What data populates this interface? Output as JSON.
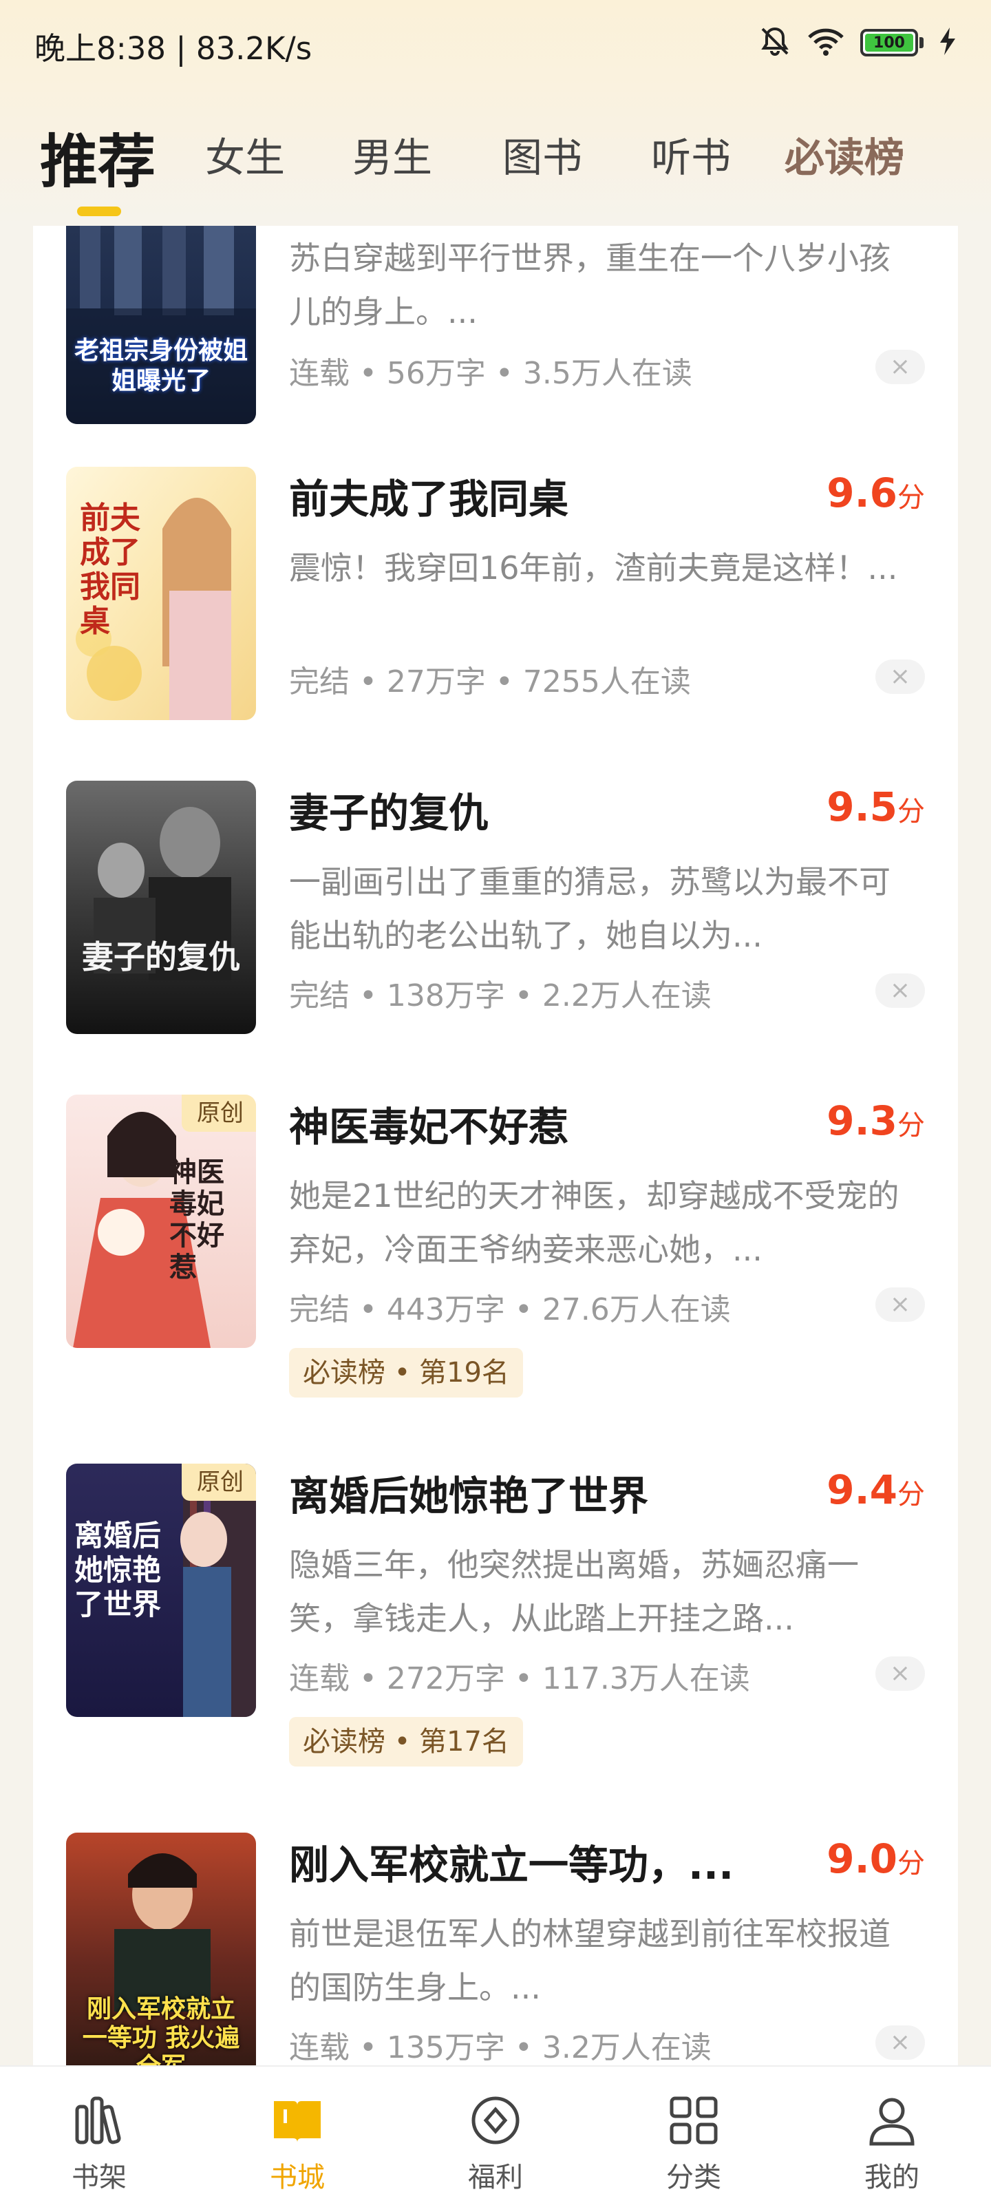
{
  "status_bar": {
    "time_speed": "晚上8:38 | 83.2K/s",
    "battery": "100",
    "icons": [
      "mute-bell-icon",
      "wifi-icon",
      "battery-icon",
      "charging-icon"
    ]
  },
  "tabs": [
    {
      "label": "推荐",
      "active": true
    },
    {
      "label": "女生"
    },
    {
      "label": "男生"
    },
    {
      "label": "图书"
    },
    {
      "label": "听书"
    },
    {
      "label": "必读榜"
    }
  ],
  "books": [
    {
      "title": "",
      "desc": "苏白穿越到平行世界，重生在一个八岁小孩儿的身上。...",
      "meta": "连载 • 56万字 • 3.5万人在读",
      "cover_text": "老祖宗身份被姐姐曝光了"
    },
    {
      "title": "前夫成了我同桌",
      "score": "9.6",
      "score_unit": "分",
      "desc": "震惊！我穿回16年前，渣前夫竟是这样！...",
      "meta": "完结 • 27万字 • 7255人在读",
      "cover_text": "前夫成了我同桌"
    },
    {
      "title": "妻子的复仇",
      "score": "9.5",
      "score_unit": "分",
      "desc": "一副画引出了重重的猜忌，苏鹭以为最不可能出轨的老公出轨了，她自以为...",
      "meta": "完结 • 138万字 • 2.2万人在读",
      "cover_text": "妻子的复仇"
    },
    {
      "title": "神医毒妃不好惹",
      "score": "9.3",
      "score_unit": "分",
      "desc": "她是21世纪的天才神医，却穿越成不受宠的弃妃，冷面王爷纳妾来恶心她，...",
      "meta": "完结 • 443万字 • 27.6万人在读",
      "badge": "原创",
      "rank_tag": "必读榜 • 第19名",
      "cover_text": "神医毒妃不好惹"
    },
    {
      "title": "离婚后她惊艳了世界",
      "score": "9.4",
      "score_unit": "分",
      "desc": "隐婚三年，他突然提出离婚，苏婳忍痛一笑，拿钱走人，从此踏上开挂之路...",
      "meta": "连载 • 272万字 • 117.3万人在读",
      "badge": "原创",
      "rank_tag": "必读榜 • 第17名",
      "cover_text": "离婚后她惊艳了世界"
    },
    {
      "title": "刚入军校就立一等功，...",
      "score": "9.0",
      "score_unit": "分",
      "desc": "前世是退伍军人的林望穿越到前往军校报道的国防生身上。...",
      "meta": "连载 • 135万字 • 3.2万人在读",
      "cover_text": "刚入军校就立一等功 我火遍全军"
    }
  ],
  "close_symbol": "×",
  "bottom_nav": [
    {
      "label": "书架",
      "icon": "bookshelf-icon"
    },
    {
      "label": "书城",
      "icon": "bookstore-icon",
      "active": true
    },
    {
      "label": "福利",
      "icon": "welfare-icon"
    },
    {
      "label": "分类",
      "icon": "category-grid-icon"
    },
    {
      "label": "我的",
      "icon": "profile-icon"
    }
  ],
  "colors": {
    "accent": "#f5c518",
    "score": "#f0441f",
    "nav_active": "#f0a500"
  }
}
